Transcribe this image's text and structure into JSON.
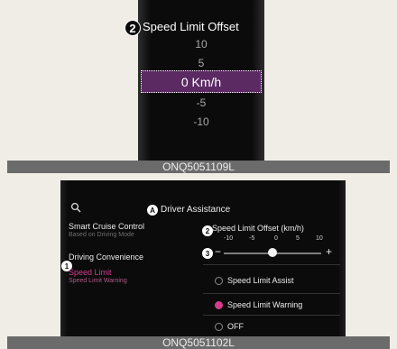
{
  "top": {
    "callout": "2",
    "title": "Speed Limit Offset",
    "values": [
      "10",
      "5",
      "0 Km/h",
      "-5",
      "-10"
    ],
    "caption": "ONQ5051109L"
  },
  "bottom": {
    "header_callout": "A",
    "header_title": "Driver Assistance",
    "menu": {
      "smart_cruise": {
        "label": "Smart Cruise Control",
        "sub": "Based on Driving Mode"
      },
      "driving_convenience": {
        "label": "Driving Convenience"
      },
      "speed_limit": {
        "label": "Speed Limit",
        "sub": "Speed Limit Warning",
        "callout": "1"
      }
    },
    "offset": {
      "callout": "2",
      "label": "Speed Limit Offset (km/h)",
      "ticks": [
        "-10",
        "-5",
        "0",
        "5",
        "10"
      ],
      "minus": "−",
      "plus": "+",
      "callout3": "3",
      "slider_value": 0
    },
    "options": [
      {
        "label": "Speed Limit Assist",
        "selected": false
      },
      {
        "label": "Speed Limit Warning",
        "selected": true
      },
      {
        "label": "OFF",
        "selected": false
      }
    ],
    "caption": "ONQ5051102L"
  },
  "colors": {
    "accent": "#d33c8b",
    "selected_bg": "#5b2a63"
  },
  "icons": {
    "search": "search-icon"
  }
}
